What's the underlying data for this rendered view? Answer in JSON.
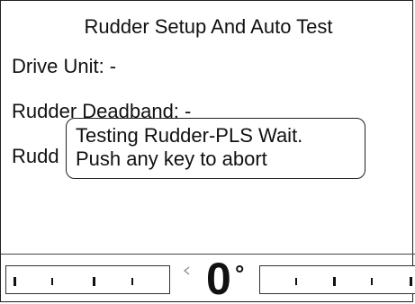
{
  "screen": {
    "title": "Rudder Setup And Auto Test",
    "rows": [
      {
        "label": "Drive Unit: -"
      },
      {
        "label": "Rudder Deadband: -"
      },
      {
        "label": "Rudd"
      }
    ]
  },
  "popup": {
    "line1": "Testing Rudder-PLS Wait.",
    "line2": "Push any key to abort"
  },
  "status_bar": {
    "rudder_angle": "0",
    "degree_symbol": "°",
    "indicator_icon": "small-chevron-left-icon"
  }
}
